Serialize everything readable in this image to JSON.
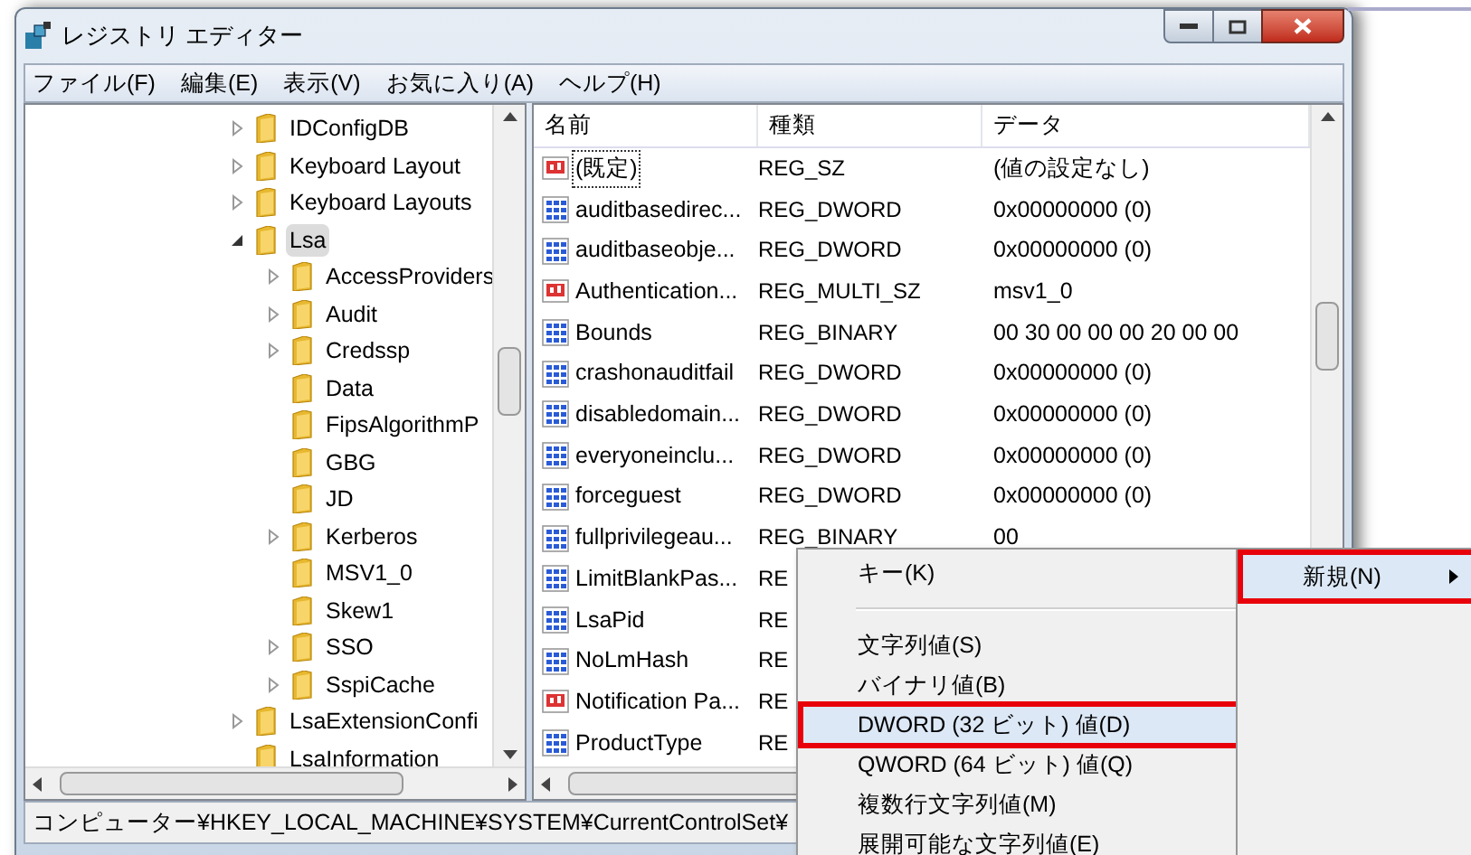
{
  "window": {
    "title": "レジストリ エディター"
  },
  "menu_bar": [
    "ファイル(F)",
    "編集(E)",
    "表示(V)",
    "お気に入り(A)",
    "ヘルプ(H)"
  ],
  "tree": [
    {
      "label": "IDConfigDB",
      "has_children": true,
      "expanded": false,
      "selected": false
    },
    {
      "label": "Keyboard Layout",
      "has_children": true,
      "expanded": false,
      "selected": false
    },
    {
      "label": "Keyboard Layouts",
      "has_children": true,
      "expanded": false,
      "selected": false
    },
    {
      "label": "Lsa",
      "has_children": true,
      "expanded": true,
      "selected": true,
      "children": [
        {
          "label": "AccessProviders",
          "has_children": true,
          "expanded": false,
          "selected": false
        },
        {
          "label": "Audit",
          "has_children": true,
          "expanded": false,
          "selected": false
        },
        {
          "label": "Credssp",
          "has_children": true,
          "expanded": false,
          "selected": false
        },
        {
          "label": "Data",
          "has_children": false,
          "selected": false
        },
        {
          "label": "FipsAlgorithmP",
          "has_children": false,
          "selected": false
        },
        {
          "label": "GBG",
          "has_children": false,
          "selected": false
        },
        {
          "label": "JD",
          "has_children": false,
          "selected": false
        },
        {
          "label": "Kerberos",
          "has_children": true,
          "expanded": false,
          "selected": false
        },
        {
          "label": "MSV1_0",
          "has_children": false,
          "selected": false
        },
        {
          "label": "Skew1",
          "has_children": false,
          "selected": false
        },
        {
          "label": "SSO",
          "has_children": true,
          "expanded": false,
          "selected": false
        },
        {
          "label": "SspiCache",
          "has_children": true,
          "expanded": false,
          "selected": false
        }
      ]
    },
    {
      "label": "LsaExtensionConfi",
      "has_children": true,
      "expanded": false,
      "selected": false
    },
    {
      "label": "LsaInformation",
      "has_children": false,
      "selected": false
    }
  ],
  "table": {
    "columns": [
      "名前",
      "種類",
      "データ"
    ],
    "rows": [
      {
        "kind": "string",
        "name": "(既定)",
        "type": "REG_SZ",
        "data": "(値の設定なし)",
        "focused": true
      },
      {
        "kind": "binary",
        "name": "auditbasedirec...",
        "type": "REG_DWORD",
        "data": "0x00000000 (0)",
        "focused": false
      },
      {
        "kind": "binary",
        "name": "auditbaseobje...",
        "type": "REG_DWORD",
        "data": "0x00000000 (0)",
        "focused": false
      },
      {
        "kind": "string",
        "name": "Authentication...",
        "type": "REG_MULTI_SZ",
        "data": "msv1_0",
        "focused": false
      },
      {
        "kind": "binary",
        "name": "Bounds",
        "type": "REG_BINARY",
        "data": "00 30 00 00 00 20 00 00",
        "focused": false
      },
      {
        "kind": "binary",
        "name": "crashonauditfail",
        "type": "REG_DWORD",
        "data": "0x00000000 (0)",
        "focused": false
      },
      {
        "kind": "binary",
        "name": "disabledomain...",
        "type": "REG_DWORD",
        "data": "0x00000000 (0)",
        "focused": false
      },
      {
        "kind": "binary",
        "name": "everyoneinclu...",
        "type": "REG_DWORD",
        "data": "0x00000000 (0)",
        "focused": false
      },
      {
        "kind": "binary",
        "name": "forceguest",
        "type": "REG_DWORD",
        "data": "0x00000000 (0)",
        "focused": false
      },
      {
        "kind": "binary",
        "name": "fullprivilegeau...",
        "type": "REG_BINARY",
        "data": "00",
        "focused": false
      },
      {
        "kind": "binary",
        "name": "LimitBlankPas...",
        "type": "RE",
        "focused": false
      },
      {
        "kind": "binary",
        "name": "LsaPid",
        "type": "RE",
        "focused": false
      },
      {
        "kind": "binary",
        "name": "NoLmHash",
        "type": "RE",
        "focused": false
      },
      {
        "kind": "string",
        "name": "Notification Pa...",
        "type": "RE",
        "focused": false
      },
      {
        "kind": "binary",
        "name": "ProductType",
        "type": "RE",
        "focused": false
      }
    ]
  },
  "status_bar": "コンピューター¥HKEY_LOCAL_MACHINE¥SYSTEM¥CurrentControlSet¥",
  "context_menu": {
    "items": [
      {
        "label": "キー(K)",
        "selected": false,
        "highlighted": false,
        "separator_after": true
      },
      {
        "label": "文字列値(S)",
        "selected": false,
        "highlighted": false,
        "separator_after": false
      },
      {
        "label": "バイナリ値(B)",
        "selected": false,
        "highlighted": false,
        "separator_after": false
      },
      {
        "label": "DWORD (32 ビット) 値(D)",
        "selected": true,
        "highlighted": true,
        "separator_after": false
      },
      {
        "label": "QWORD (64 ビット) 値(Q)",
        "selected": false,
        "highlighted": false,
        "separator_after": false
      },
      {
        "label": "複数行文字列値(M)",
        "selected": false,
        "highlighted": false,
        "separator_after": false
      },
      {
        "label": "展開可能な文字列値(E)",
        "selected": false,
        "highlighted": false,
        "separator_after": false
      }
    ]
  },
  "parent_menu": {
    "items": [
      {
        "label": "新規(N)",
        "selected": true,
        "highlighted": true,
        "has_submenu": true
      }
    ]
  }
}
